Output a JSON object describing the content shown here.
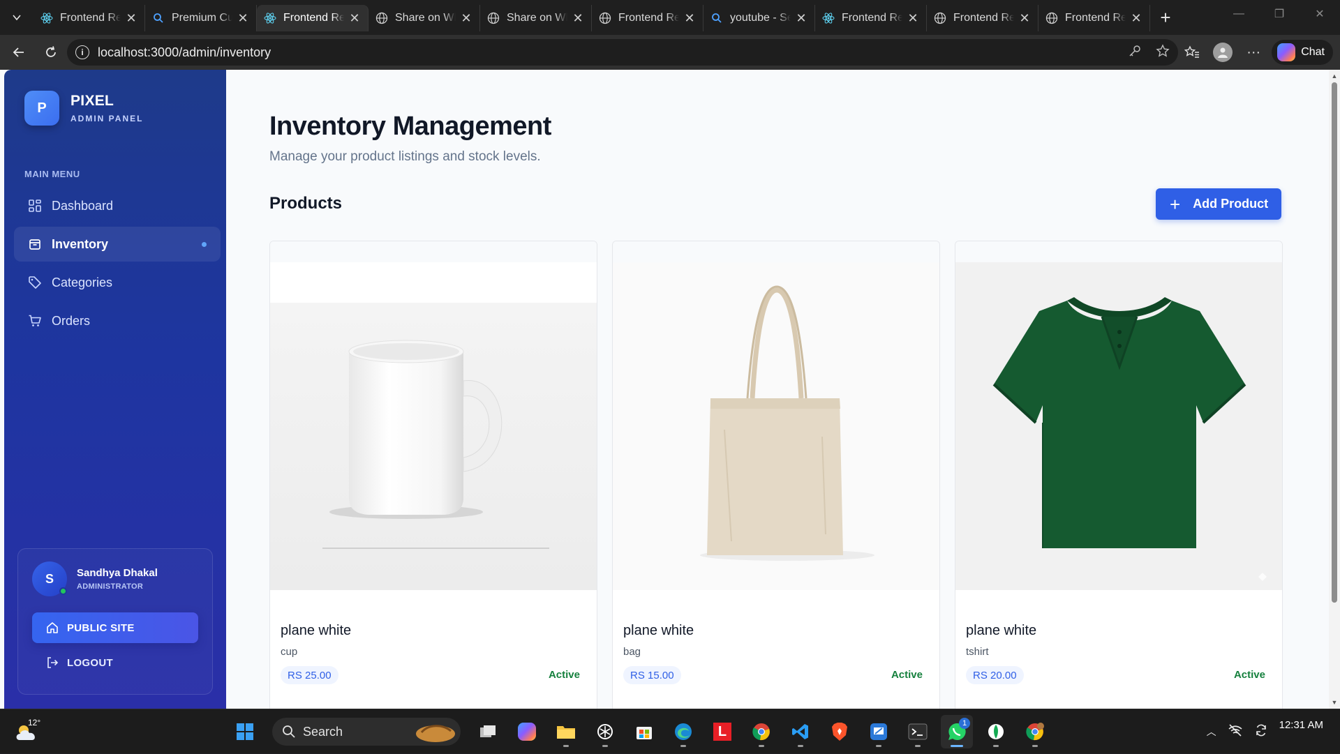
{
  "browser": {
    "tabs": [
      {
        "label": "Frontend React",
        "icon": "react-icon",
        "active": false
      },
      {
        "label": "Premium Custom",
        "icon": "search-icon",
        "active": false
      },
      {
        "label": "Frontend React",
        "icon": "react-icon",
        "active": true
      },
      {
        "label": "Share on WhatsApp",
        "icon": "globe-icon",
        "active": false
      },
      {
        "label": "Share on WhatsApp",
        "icon": "globe-icon",
        "active": false
      },
      {
        "label": "Frontend React",
        "icon": "globe-icon",
        "active": false
      },
      {
        "label": "youtube - Search",
        "icon": "search-icon",
        "active": false
      },
      {
        "label": "Frontend React",
        "icon": "react-icon",
        "active": false
      },
      {
        "label": "Frontend React",
        "icon": "globe-icon",
        "active": false
      },
      {
        "label": "Frontend React",
        "icon": "globe-icon",
        "active": false
      }
    ],
    "url": "localhost:3000/admin/inventory",
    "chat_label": "Chat"
  },
  "sidebar": {
    "brand_initial": "P",
    "brand_title": "PIXEL",
    "brand_subtitle": "ADMIN PANEL",
    "menu_label": "MAIN MENU",
    "items": [
      {
        "label": "Dashboard",
        "icon": "grid-icon",
        "active": false
      },
      {
        "label": "Inventory",
        "icon": "box-icon",
        "active": true
      },
      {
        "label": "Categories",
        "icon": "tag-icon",
        "active": false
      },
      {
        "label": "Orders",
        "icon": "cart-icon",
        "active": false
      }
    ],
    "user": {
      "initial": "S",
      "name": "Sandhya Dhakal",
      "role": "ADMINISTRATOR"
    },
    "public_site_label": "PUBLIC SITE",
    "logout_label": "LOGOUT"
  },
  "main": {
    "title": "Inventory Management",
    "subtitle": "Manage your product listings and stock levels.",
    "section_title": "Products",
    "add_button_label": "Add Product",
    "products": [
      {
        "name": "plane white",
        "category": "cup",
        "price": "RS 25.00",
        "status": "Active",
        "image": "mug-image"
      },
      {
        "name": "plane white",
        "category": "bag",
        "price": "RS 15.00",
        "status": "Active",
        "image": "tote-bag-image"
      },
      {
        "name": "plane white",
        "category": "tshirt",
        "price": "RS 20.00",
        "status": "Active",
        "image": "polo-shirt-image"
      }
    ]
  },
  "taskbar": {
    "weather_temp": "12°",
    "search_label": "Search",
    "clock_time": "12:31 AM",
    "whatsapp_badge": "1"
  },
  "colors": {
    "accent": "#2f5fe6",
    "sidebar_top": "#1e3a8a",
    "status_active": "#15803d"
  }
}
